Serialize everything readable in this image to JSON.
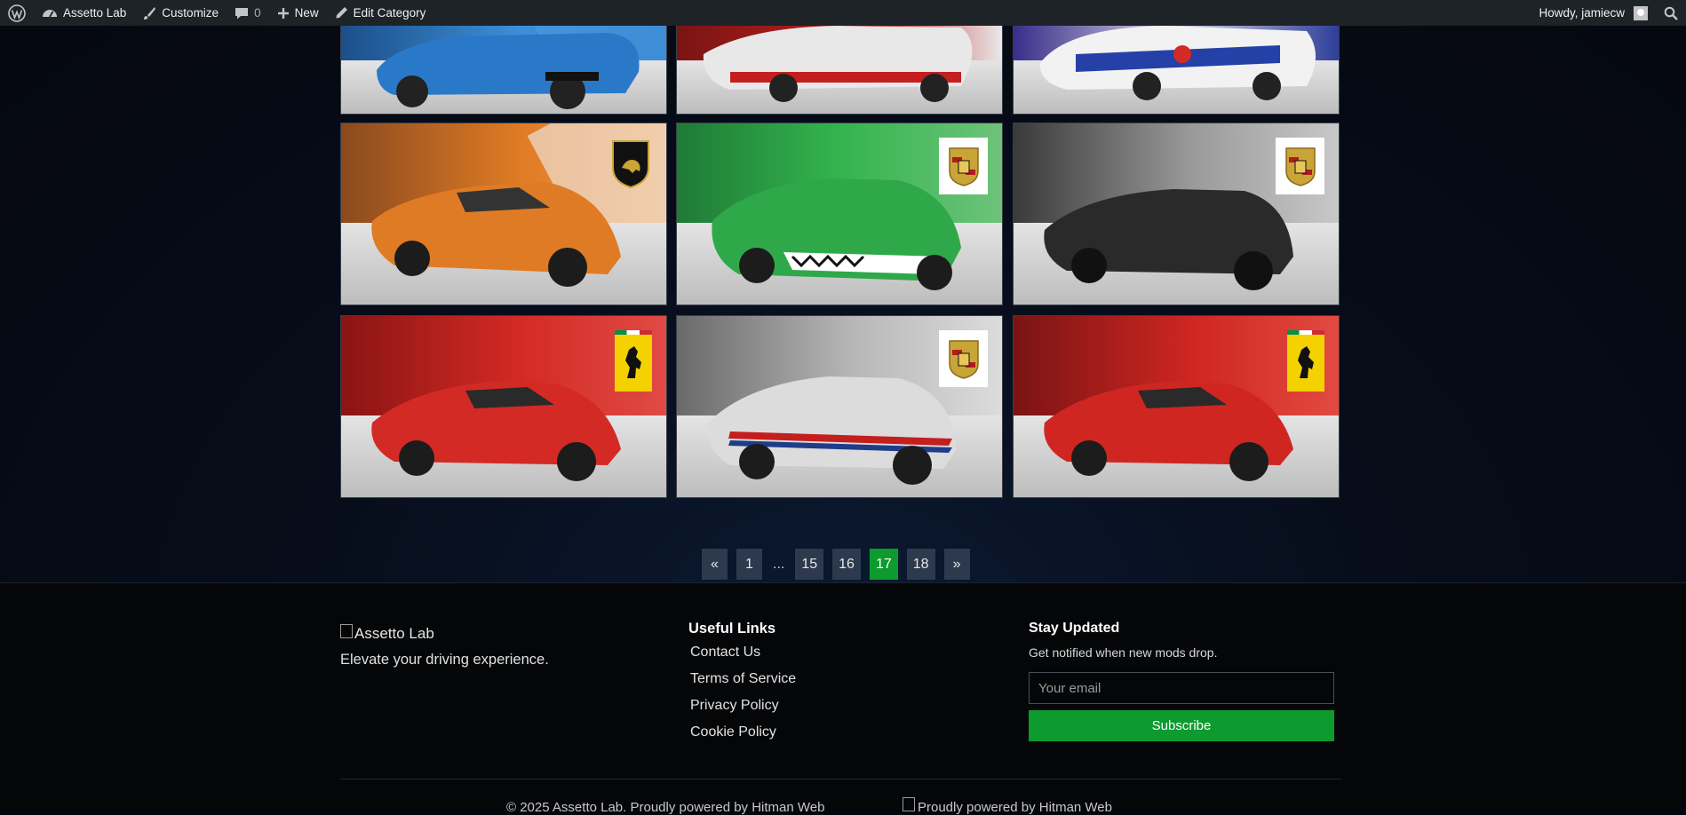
{
  "adminbar": {
    "site_name": "Assetto Lab",
    "customize": "Customize",
    "comments_count": "0",
    "new_label": "New",
    "edit_category": "Edit Category",
    "howdy": "Howdy, jamiecw"
  },
  "gallery": {
    "tiles": [
      {
        "bg": "blue",
        "badge": "none",
        "car_color": "#2a79c8"
      },
      {
        "bg": "red",
        "badge": "none",
        "car_color": "#d6d6d6"
      },
      {
        "bg": "blue",
        "badge": "none",
        "car_color": "#eaeaea"
      },
      {
        "bg": "orange",
        "badge": "lamborghini",
        "car_color": "#e07b25"
      },
      {
        "bg": "green",
        "badge": "porsche",
        "car_color": "#2fa84a"
      },
      {
        "bg": "grey",
        "badge": "porsche",
        "car_color": "#2a2a2a"
      },
      {
        "bg": "red",
        "badge": "ferrari",
        "car_color": "#d42a25"
      },
      {
        "bg": "grey",
        "badge": "porsche",
        "car_color": "#d8d8d8"
      },
      {
        "bg": "red",
        "badge": "ferrari",
        "car_color": "#cf2622"
      }
    ]
  },
  "pagination": {
    "prev": "«",
    "pages": [
      "1",
      "15",
      "16",
      "17",
      "18"
    ],
    "ellipsis": "...",
    "current": "17",
    "next": "»"
  },
  "footer": {
    "logo_alt": "Assetto Lab",
    "tagline": "Elevate your driving experience.",
    "links_title": "Useful Links",
    "links": [
      "Contact Us",
      "Terms of Service",
      "Privacy Policy",
      "Cookie Policy"
    ],
    "stay_title": "Stay Updated",
    "stay_subtitle": "Get notified when new mods drop.",
    "email_placeholder": "Your email",
    "subscribe_label": "Subscribe",
    "copyright": "© 2025 Assetto Lab. Proudly powered by Hitman Web",
    "credit_alt": "Proudly powered by Hitman Web"
  },
  "colors": {
    "accent": "#0d9a2e",
    "adminbar_bg": "#1d2327",
    "page_number_bg": "#2d3a4d"
  }
}
